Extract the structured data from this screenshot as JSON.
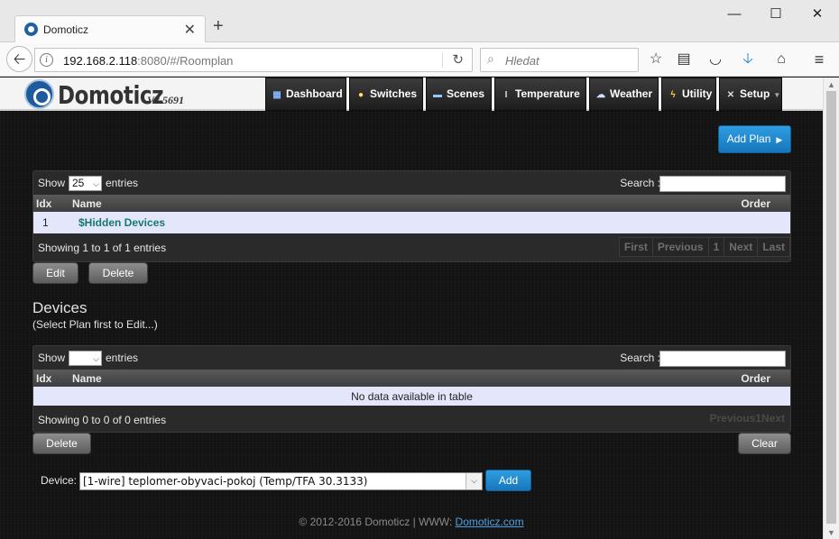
{
  "browser": {
    "tab_title": "Domoticz",
    "url_host": "192.168.2.118",
    "url_rest": ":8080/#/Roomplan",
    "search_placeholder": "Hledat"
  },
  "app": {
    "logo_text": "Domoticz",
    "version": "V3.5691",
    "menu": {
      "dashboard": "Dashboard",
      "switches": "Switches",
      "scenes": "Scenes",
      "temperature": "Temperature",
      "weather": "Weather",
      "utility": "Utility",
      "setup": "Setup"
    }
  },
  "plans": {
    "add_button": "Add Plan",
    "show_label": "Show",
    "page_size": "25",
    "entries_label": "entries",
    "search_label": "Search :",
    "columns": {
      "idx": "Idx",
      "name": "Name",
      "order": "Order"
    },
    "rows": [
      {
        "idx": "1",
        "name": "$Hidden Devices"
      }
    ],
    "info": "Showing 1 to 1 of 1 entries",
    "pager": {
      "first": "First",
      "previous": "Previous",
      "page": "1",
      "next": "Next",
      "last": "Last"
    },
    "edit_button": "Edit",
    "delete_button": "Delete"
  },
  "devices": {
    "heading": "Devices",
    "subheading": "(Select Plan first to Edit...)",
    "show_label": "Show",
    "entries_label": "entries",
    "search_label": "Search :",
    "columns": {
      "idx": "Idx",
      "name": "Name",
      "order": "Order"
    },
    "empty": "No data available in table",
    "info": "Showing 0 to 0 of 0 entries",
    "pager": {
      "previous": "Previous",
      "page": "1",
      "next": "Next"
    },
    "delete_button": "Delete",
    "clear_button": "Clear",
    "device_label": "Device:",
    "device_selected": "[1-wire] teplomer-obyvaci-pokoj (Temp/TFA 30.3133)",
    "add_button": "Add"
  },
  "footer": {
    "text": "© 2012-2016 Domoticz | WWW: ",
    "link": "Domoticz.com"
  }
}
